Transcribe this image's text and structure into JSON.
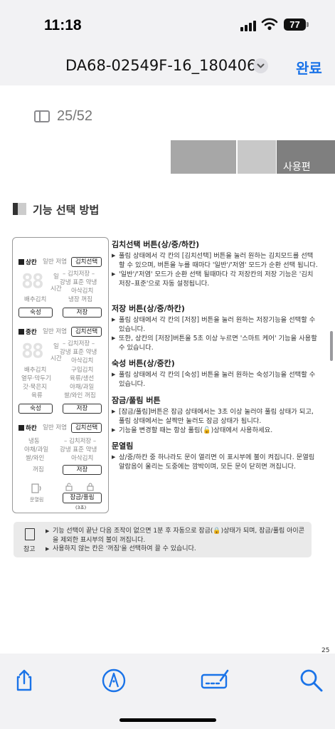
{
  "status": {
    "time": "11:18",
    "battery": "77"
  },
  "nav": {
    "title": "DA68-02549F-16_180406",
    "done_label": "완료"
  },
  "viewer": {
    "page_indicator": "25/52"
  },
  "doc": {
    "section_tab": "사용편",
    "section_title": "기능 선택 방법",
    "panel": {
      "upper": {
        "name": "상칸",
        "modes": "일반 저염",
        "button": "김치선택",
        "digits": "88",
        "unit1": "일",
        "unit2": "시간",
        "opts": [
          "– 김치저장 –",
          "강냉 표준 약냉",
          "아삭김치",
          "냉장 꺼짐"
        ],
        "left_opt": "배추김치",
        "btn_left": "숙성",
        "btn_right": "저장"
      },
      "middle": {
        "name": "중칸",
        "modes": "일반 저염",
        "button": "김치선택",
        "digits": "88",
        "unit1": "일",
        "unit2": "시간",
        "opts": [
          "– 김치저장 –",
          "강냉 표준 약냉",
          "아삭김치"
        ],
        "grid": [
          [
            "배추김치",
            "구입김치"
          ],
          [
            "열무·막두기",
            "육류/생선"
          ],
          [
            "갓·묵은지",
            "야채/과일"
          ],
          [
            "육류",
            "쌀/와인 꺼짐"
          ]
        ],
        "btn_left": "숙성",
        "btn_right": "저장"
      },
      "lower": {
        "name": "하칸",
        "modes": "일반 저염",
        "button": "김치선택",
        "grid": [
          [
            "냉동",
            "– 김치저장 –"
          ],
          [
            "야채/과일",
            "강냉 표준 약냉"
          ],
          [
            "쌀/와인",
            "아삭김치"
          ],
          [
            "꺼짐",
            "저장"
          ]
        ]
      },
      "bottom": {
        "left_label": "문열림",
        "lock_button": "잠금/풀림",
        "lock_sub": "(3초)"
      }
    },
    "sections": [
      {
        "heading": "김치선택 버튼(상/중/하칸)",
        "bullets": [
          "풀림 상태에서 각 칸의 [김치선택] 버튼을 눌러 원하는 김치모드를 선택할 수 있으며, 버튼을 누를 때마다 '일반'/'저염' 모드가 순환 선택 됩니다.",
          "'일반'/'저염' 모드가 순환 선택 될때마다 각 저장칸의 저장 기능은 '김치저장–표준'으로 자동 설정됩니다."
        ]
      },
      {
        "heading": "저장 버튼(상/중/하칸)",
        "bullets": [
          "풀림 상태에서 각 칸의 [저장] 버튼을 눌러 원하는 저장기능을 선택할 수 있습니다.",
          "또한, 상칸의 [저장]버튼을 5초 이상 누르면 '스마트 케어' 기능을 사용할 수 있습니다."
        ]
      },
      {
        "heading": "숙성 버튼(상/중칸)",
        "bullets": [
          "풀림 상태에서 각 칸의 [숙성] 버튼을 눌러 원하는 숙성기능을 선택할 수 있습니다."
        ]
      },
      {
        "heading": "잠금/풀림 버튼",
        "bullets": [
          "[잠금/풀림]버튼은 잠금 상태에서는 3초 이상 눌러야 풀림 상태가 되고, 풀림 상태에서는 살짝만 눌러도 잠금 상태가 됩니다.",
          "기능을 변경할 때는 항상 풀림(🔓)상태에서 사용하세요."
        ]
      },
      {
        "heading": "문열림",
        "bullets": [
          "상/중/하칸 중 하나라도 문이 열리면 이 표시부에 불이 켜집니다. 문열림 알람음이 울리는 도중에는 깜박이며, 모든 문이 닫히면 꺼집니다."
        ]
      }
    ],
    "note": {
      "label": "참고",
      "bullets": [
        "기능 선택이 끝난 다음 조작이 없으면 1분 후 자동으로 잠금(🔒)상태가 되며, 잠금/풀림 아이콘을 제외한 표시부의 불이 꺼집니다.",
        "사용하지 않는 칸은 '꺼짐'을 선택하여 끌 수 있습니다."
      ]
    },
    "page_number": "25"
  },
  "toolbar": {
    "icons": [
      "share-icon",
      "markup-pen-icon",
      "signature-icon",
      "search-icon"
    ]
  }
}
